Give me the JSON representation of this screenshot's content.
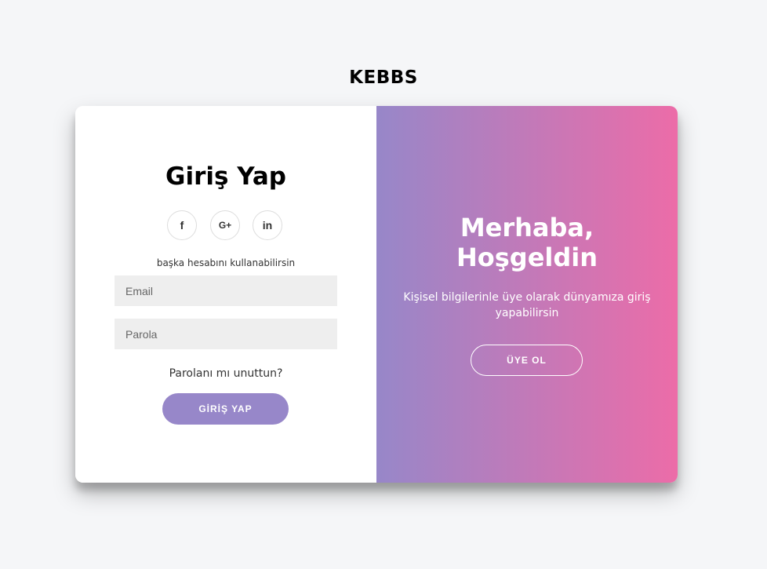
{
  "brand": "KEBBS",
  "signin": {
    "title": "Giriş Yap",
    "social": [
      {
        "icon": "facebook-icon",
        "glyph": "f"
      },
      {
        "icon": "google-plus-icon",
        "glyph": "G+"
      },
      {
        "icon": "linkedin-icon",
        "glyph": "in"
      }
    ],
    "hint": "başka hesabını kullanabilirsin",
    "email_placeholder": "Email",
    "password_placeholder": "Parola",
    "forgot_label": "Parolanı mı unuttun?",
    "login_label": "GİRİŞ YAP"
  },
  "overlay": {
    "title_line1": "Merhaba,",
    "title_line2": "Hoşgeldin",
    "text": "Kişisel bilgilerinle üye olarak dünyamıza giriş yapabilirsin",
    "signup_label": "ÜYE OL"
  },
  "colors": {
    "background": "#f5f6f8",
    "gradient_start": "#9787c9",
    "gradient_end": "#ec6ca8",
    "button": "#9787c9",
    "input": "#eeeeee"
  }
}
